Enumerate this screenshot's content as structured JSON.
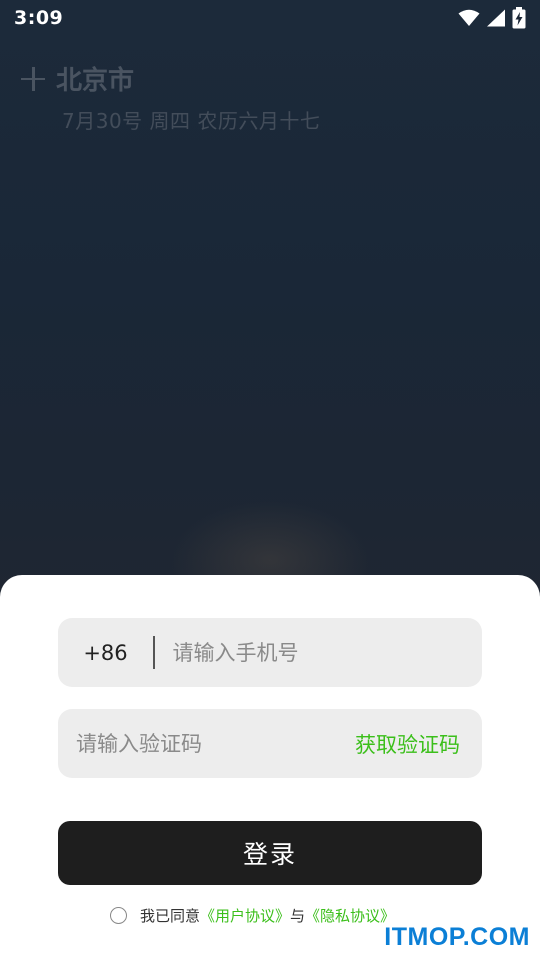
{
  "status_bar": {
    "time": "3:09",
    "icons": [
      "wifi-icon",
      "signal-icon",
      "battery-charging-icon"
    ]
  },
  "weather": {
    "add_icon": "plus-icon",
    "city": "北京市",
    "date": "7月30号 周四 农历六月十七"
  },
  "login": {
    "country_code": "+86",
    "phone_placeholder": "请输入手机号",
    "code_placeholder": "请输入验证码",
    "get_code_label": "获取验证码",
    "login_label": "登录",
    "agreement_prefix": "我已同意",
    "user_agreement": "《用户协议》",
    "and": "与",
    "privacy_policy": "《隐私协议》"
  },
  "watermark": "ITMOP.COM",
  "colors": {
    "accent_green": "#3bbf1a",
    "button_dark": "#1e1e1e",
    "field_bg": "#ededed",
    "watermark_blue": "#0b7fd6"
  }
}
